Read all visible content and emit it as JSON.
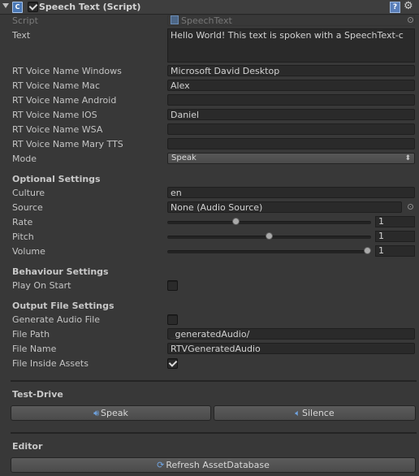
{
  "header": {
    "title": "Speech Text (Script)",
    "enabled": true,
    "icons": {
      "component": "csharp-script-icon",
      "help": "help-icon",
      "settings": "gear-icon"
    }
  },
  "fields": {
    "script": {
      "label": "Script",
      "value": "SpeechText"
    },
    "text": {
      "label": "Text",
      "value": "Hello World! This text is spoken with a SpeechText-c"
    },
    "rt_windows": {
      "label": "RT Voice Name Windows",
      "value": "Microsoft David Desktop"
    },
    "rt_mac": {
      "label": "RT Voice Name Mac",
      "value": "Alex"
    },
    "rt_android": {
      "label": "RT Voice Name Android",
      "value": ""
    },
    "rt_ios": {
      "label": "RT Voice Name IOS",
      "value": "Daniel"
    },
    "rt_wsa": {
      "label": "RT Voice Name WSA",
      "value": ""
    },
    "rt_mary": {
      "label": "RT Voice Name Mary TTS",
      "value": ""
    },
    "mode": {
      "label": "Mode",
      "value": "Speak"
    }
  },
  "optional": {
    "heading": "Optional Settings",
    "culture": {
      "label": "Culture",
      "value": "en"
    },
    "source": {
      "label": "Source",
      "value": "None (Audio Source)"
    },
    "rate": {
      "label": "Rate",
      "value": "1",
      "level": 0.33
    },
    "pitch": {
      "label": "Pitch",
      "value": "1",
      "level": 0.5
    },
    "volume": {
      "label": "Volume",
      "value": "1",
      "level": 1.0
    }
  },
  "behaviour": {
    "heading": "Behaviour Settings",
    "play_on_start": {
      "label": "Play On Start",
      "checked": false
    }
  },
  "output": {
    "heading": "Output File Settings",
    "generate_audio": {
      "label": "Generate Audio File",
      "checked": false
    },
    "file_path": {
      "label": "File Path",
      "value": "_generatedAudio/"
    },
    "file_name": {
      "label": "File Name",
      "value": "RTVGeneratedAudio"
    },
    "inside_assets": {
      "label": "File Inside Assets",
      "checked": true
    }
  },
  "test_drive": {
    "heading": "Test-Drive",
    "speak_label": "Speak",
    "silence_label": "Silence"
  },
  "editor": {
    "heading": "Editor",
    "refresh_label": "Refresh AssetDatabase"
  },
  "colors": {
    "background": "#383838",
    "field": "#2a2a2a",
    "accent": "#6fa3e0"
  }
}
